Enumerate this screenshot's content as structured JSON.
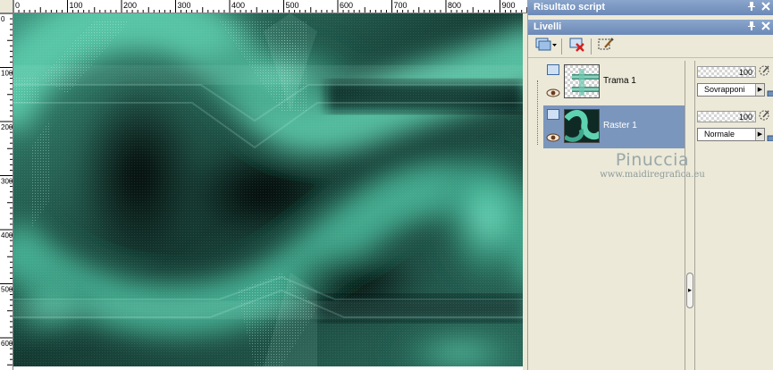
{
  "rulers": {
    "top_labels": [
      "0",
      "100",
      "200",
      "300",
      "400",
      "500",
      "600",
      "700",
      "800",
      "900"
    ],
    "left_labels": [
      "0",
      "100",
      "200",
      "300",
      "400",
      "500",
      "600"
    ]
  },
  "panels": {
    "script": {
      "title": "Risultato script"
    },
    "layers": {
      "title": "Livelli"
    }
  },
  "layers": [
    {
      "name": "Trama 1",
      "opacity": "100",
      "blend_mode": "Sovrapponi",
      "selected": false
    },
    {
      "name": "Raster 1",
      "opacity": "100",
      "blend_mode": "Normale",
      "selected": true
    }
  ],
  "watermark": {
    "name": "Pinuccia",
    "url": "www.maidiregrafica.eu"
  },
  "icons": {
    "panel_pin": "pin-icon",
    "panel_close": "close-icon",
    "new_layer": "new-layer-icon",
    "delete_layer": "delete-layer-icon",
    "edit_mask": "edit-selection-icon",
    "visibility": "eye-icon",
    "lock": "lock-icon",
    "chain": "link-icon"
  },
  "colors": {
    "title_bar": "#6b89b7",
    "selected_layer": "#7b96bd",
    "panel_bg": "#ece9d8",
    "canvas_teal": "#4fc9a8",
    "canvas_dark": "#0d1d18"
  }
}
